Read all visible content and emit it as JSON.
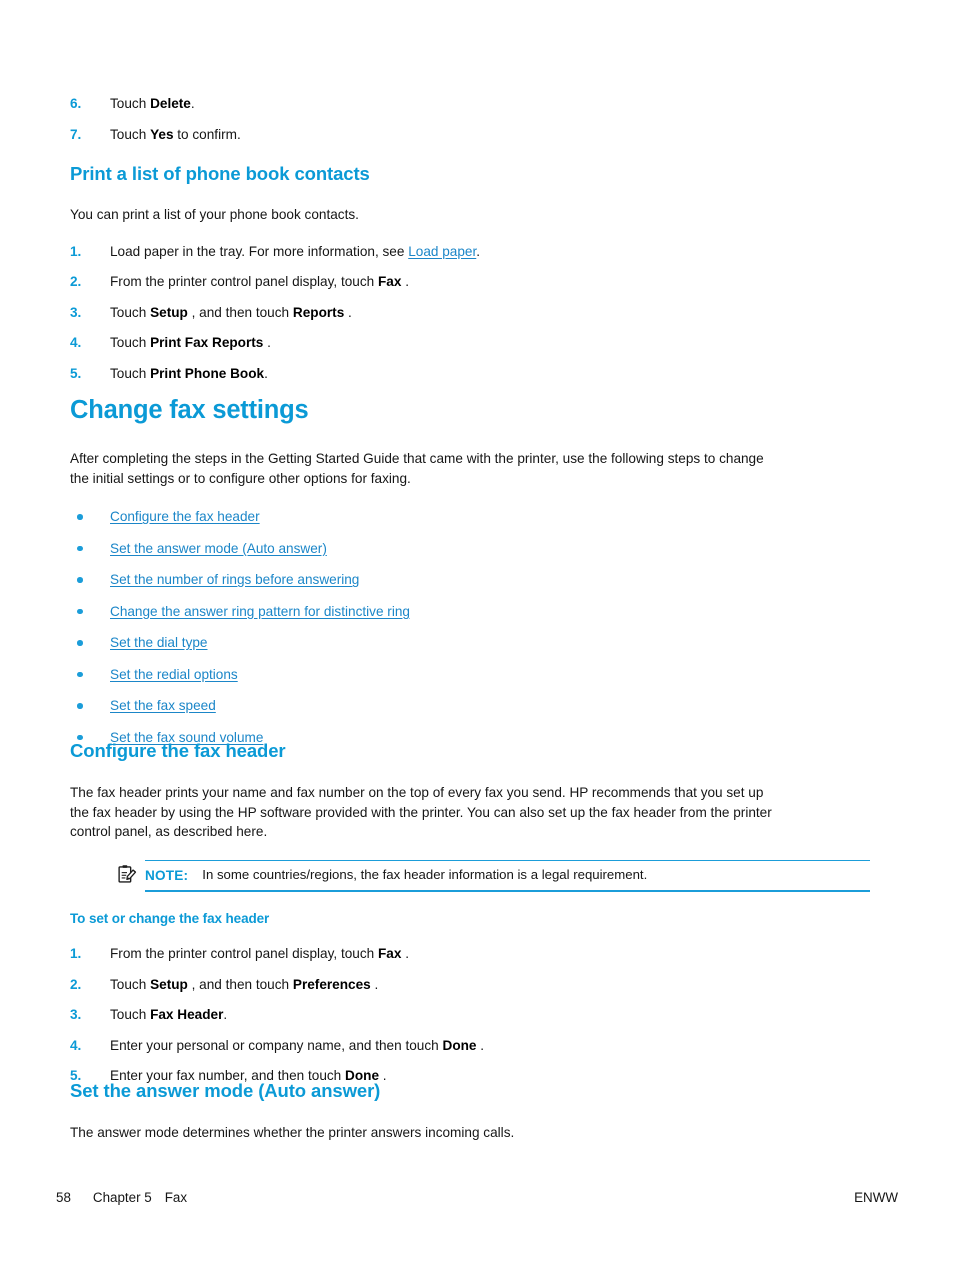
{
  "page": {
    "number": "58",
    "chapter": "Chapter 5",
    "chapter_title": "Fax",
    "locale_code": "ENWW",
    "accent_blue": "#0b9ad6",
    "link_blue": "#1b86c8",
    "bullet_blue": "#1b9dd9"
  },
  "top_steps": [
    {
      "num": "6.",
      "prefix": "Touch ",
      "bold": "Delete",
      "suffix": "."
    },
    {
      "num": "7.",
      "prefix": "Touch ",
      "bold": "Yes",
      "suffix": " to confirm."
    }
  ],
  "section_print_list": {
    "heading": "Print a list of phone book contacts",
    "intro": "You can print a list of your phone book contacts.",
    "steps": [
      {
        "num": "1.",
        "prefix": "Load paper in the tray. For more information, see ",
        "link": "Load paper",
        "suffix": "."
      },
      {
        "num": "2.",
        "prefix": "From the printer control panel display, touch ",
        "bold": "Fax",
        "suffix": " ."
      },
      {
        "num": "3.",
        "prefix": "Touch ",
        "bold": "Setup",
        "mid": " , and then touch ",
        "bold2": "Reports",
        "suffix": " ."
      },
      {
        "num": "4.",
        "prefix": "Touch ",
        "bold": "Print Fax Reports",
        "suffix": " ."
      },
      {
        "num": "5.",
        "prefix": "Touch ",
        "bold": "Print Phone Book",
        "suffix": "."
      }
    ]
  },
  "section_change_fax": {
    "heading": "Change fax settings",
    "intro": "After completing the steps in the Getting Started Guide that came with the printer, use the following steps to change the initial settings or to configure other options for faxing.",
    "links": [
      "Configure the fax header",
      "Set the answer mode (Auto answer)",
      "Set the number of rings before answering",
      "Change the answer ring pattern for distinctive ring",
      "Set the dial type",
      "Set the redial options",
      "Set the fax speed",
      "Set the fax sound volume"
    ]
  },
  "section_configure_header": {
    "heading": "Configure the fax header",
    "body": "The fax header prints your name and fax number on the top of every fax you send. HP recommends that you set up the fax header by using the HP software provided with the printer. You can also set up the fax header from the printer control panel, as described here.",
    "note": {
      "icon": "note-clipboard-pencil-icon",
      "label": "NOTE:",
      "text": "In some countries/regions, the fax header information is a legal requirement."
    },
    "subheading": "To set or change the fax header",
    "steps": [
      {
        "num": "1.",
        "prefix": "From the printer control panel display, touch ",
        "bold": "Fax",
        "suffix": " ."
      },
      {
        "num": "2.",
        "prefix": "Touch ",
        "bold": "Setup",
        "mid": " , and then touch ",
        "bold2": "Preferences",
        "suffix": " ."
      },
      {
        "num": "3.",
        "prefix": "Touch ",
        "bold": "Fax Header",
        "suffix": "."
      },
      {
        "num": "4.",
        "prefix": "Enter your personal or company name, and then touch ",
        "bold": "Done",
        "suffix": " ."
      },
      {
        "num": "5.",
        "prefix": "Enter your fax number, and then touch ",
        "bold": "Done",
        "suffix": " ."
      }
    ]
  },
  "section_answer_mode": {
    "heading": "Set the answer mode (Auto answer)",
    "body": "The answer mode determines whether the printer answers incoming calls."
  }
}
